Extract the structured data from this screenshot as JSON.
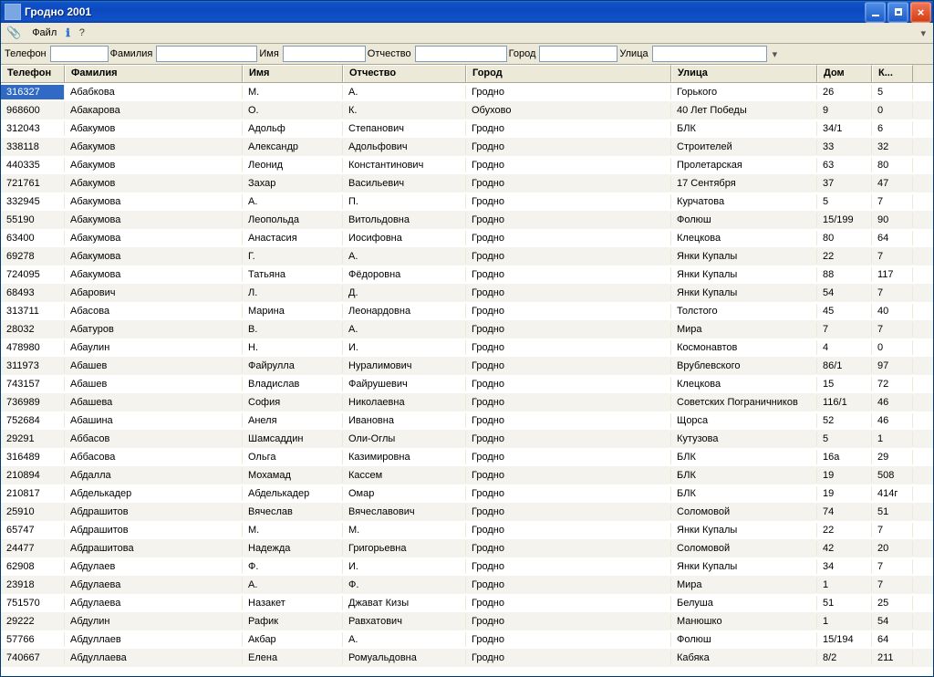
{
  "window": {
    "title": "Гродно 2001"
  },
  "menu": {
    "file": "Файл",
    "help": "?"
  },
  "filters": {
    "phone_label": "Телефон",
    "last_label": "Фамилия",
    "first_label": "Имя",
    "patronymic_label": "Отчество",
    "city_label": "Город",
    "street_label": "Улица"
  },
  "columns": [
    "Телефон",
    "Фамилия",
    "Имя",
    "Отчество",
    "Город",
    "Улица",
    "Дом",
    "К..."
  ],
  "selected_row": 0,
  "selected_col": 0,
  "rows": [
    [
      "316327",
      "Абабкова",
      "М.",
      "А.",
      "Гродно",
      "Горького",
      "26",
      "5"
    ],
    [
      "968600",
      "Абакарова",
      "О.",
      "К.",
      "Обухово",
      "40 Лет Победы",
      "9",
      "0"
    ],
    [
      "312043",
      "Абакумов",
      "Адольф",
      "Степанович",
      "Гродно",
      "БЛК",
      "34/1",
      "6"
    ],
    [
      "338118",
      "Абакумов",
      "Александр",
      "Адольфович",
      "Гродно",
      "Строителей",
      "33",
      "32"
    ],
    [
      "440335",
      "Абакумов",
      "Леонид",
      "Константинович",
      "Гродно",
      "Пролетарская",
      "63",
      "80"
    ],
    [
      "721761",
      "Абакумов",
      "Захар",
      "Васильевич",
      "Гродно",
      "17 Сентября",
      "37",
      "47"
    ],
    [
      "332945",
      "Абакумова",
      "А.",
      "П.",
      "Гродно",
      "Курчатова",
      "5",
      "7"
    ],
    [
      "55190",
      "Абакумова",
      "Леопольда",
      "Витольдовна",
      "Гродно",
      "Фолюш",
      "15/199",
      "90"
    ],
    [
      "63400",
      "Абакумова",
      "Анастасия",
      "Иосифовна",
      "Гродно",
      "Клецкова",
      "80",
      "64"
    ],
    [
      "69278",
      "Абакумова",
      "Г.",
      "А.",
      "Гродно",
      "Янки Купалы",
      "22",
      "7"
    ],
    [
      "724095",
      "Абакумова",
      "Татьяна",
      "Фёдоровна",
      "Гродно",
      "Янки Купалы",
      "88",
      "117"
    ],
    [
      "68493",
      "Абарович",
      "Л.",
      "Д.",
      "Гродно",
      "Янки Купалы",
      "54",
      "7"
    ],
    [
      "313711",
      "Абасова",
      "Марина",
      "Леонардовна",
      "Гродно",
      "Толстого",
      "45",
      "40"
    ],
    [
      "28032",
      "Абатуров",
      "В.",
      "А.",
      "Гродно",
      "Мира",
      "7",
      "7"
    ],
    [
      "478980",
      "Абаулин",
      "Н.",
      "И.",
      "Гродно",
      "Космонавтов",
      "4",
      "0"
    ],
    [
      "311973",
      "Абашев",
      "Файрулла",
      "Нуралимович",
      "Гродно",
      "Врублевского",
      "86/1",
      "97"
    ],
    [
      "743157",
      "Абашев",
      "Владислав",
      "Файрушевич",
      "Гродно",
      "Клецкова",
      "15",
      "72"
    ],
    [
      "736989",
      "Абашева",
      "София",
      "Николаевна",
      "Гродно",
      "Советских Пограничников",
      "116/1",
      "46"
    ],
    [
      "752684",
      "Абашина",
      "Анеля",
      "Ивановна",
      "Гродно",
      "Щорса",
      "52",
      "46"
    ],
    [
      "29291",
      "Аббасов",
      "Шамсаддин",
      "Оли-Оглы",
      "Гродно",
      "Кутузова",
      "5",
      "1"
    ],
    [
      "316489",
      "Аббасова",
      "Ольга",
      "Казимировна",
      "Гродно",
      "БЛК",
      "16а",
      "29"
    ],
    [
      "210894",
      "Абдалла",
      "Мохамад",
      "Кассем",
      "Гродно",
      "БЛК",
      "19",
      "508"
    ],
    [
      "210817",
      "Абделькадер",
      "Абделькадер",
      "Омар",
      "Гродно",
      "БЛК",
      "19",
      "414г"
    ],
    [
      "25910",
      "Абдрашитов",
      "Вячеслав",
      "Вячеславович",
      "Гродно",
      "Соломовой",
      "74",
      "51"
    ],
    [
      "65747",
      "Абдрашитов",
      "М.",
      "М.",
      "Гродно",
      "Янки Купалы",
      "22",
      "7"
    ],
    [
      "24477",
      "Абдрашитова",
      "Надежда",
      "Григорьевна",
      "Гродно",
      "Соломовой",
      "42",
      "20"
    ],
    [
      "62908",
      "Абдулаев",
      "Ф.",
      "И.",
      "Гродно",
      "Янки Купалы",
      "34",
      "7"
    ],
    [
      "23918",
      "Абдулаева",
      "А.",
      "Ф.",
      "Гродно",
      "Мира",
      "1",
      "7"
    ],
    [
      "751570",
      "Абдулаева",
      "Назакет",
      "Джават Кизы",
      "Гродно",
      "Белуша",
      "51",
      "25"
    ],
    [
      "29222",
      "Абдулин",
      "Рафик",
      "Равхатович",
      "Гродно",
      "Манюшко",
      "1",
      "54"
    ],
    [
      "57766",
      "Абдуллаев",
      "Акбар",
      "А.",
      "Гродно",
      "Фолюш",
      "15/194",
      "64"
    ],
    [
      "740667",
      "Абдуллаева",
      "Елена",
      "Ромуальдовна",
      "Гродно",
      "Кабяка",
      "8/2",
      "211"
    ]
  ]
}
